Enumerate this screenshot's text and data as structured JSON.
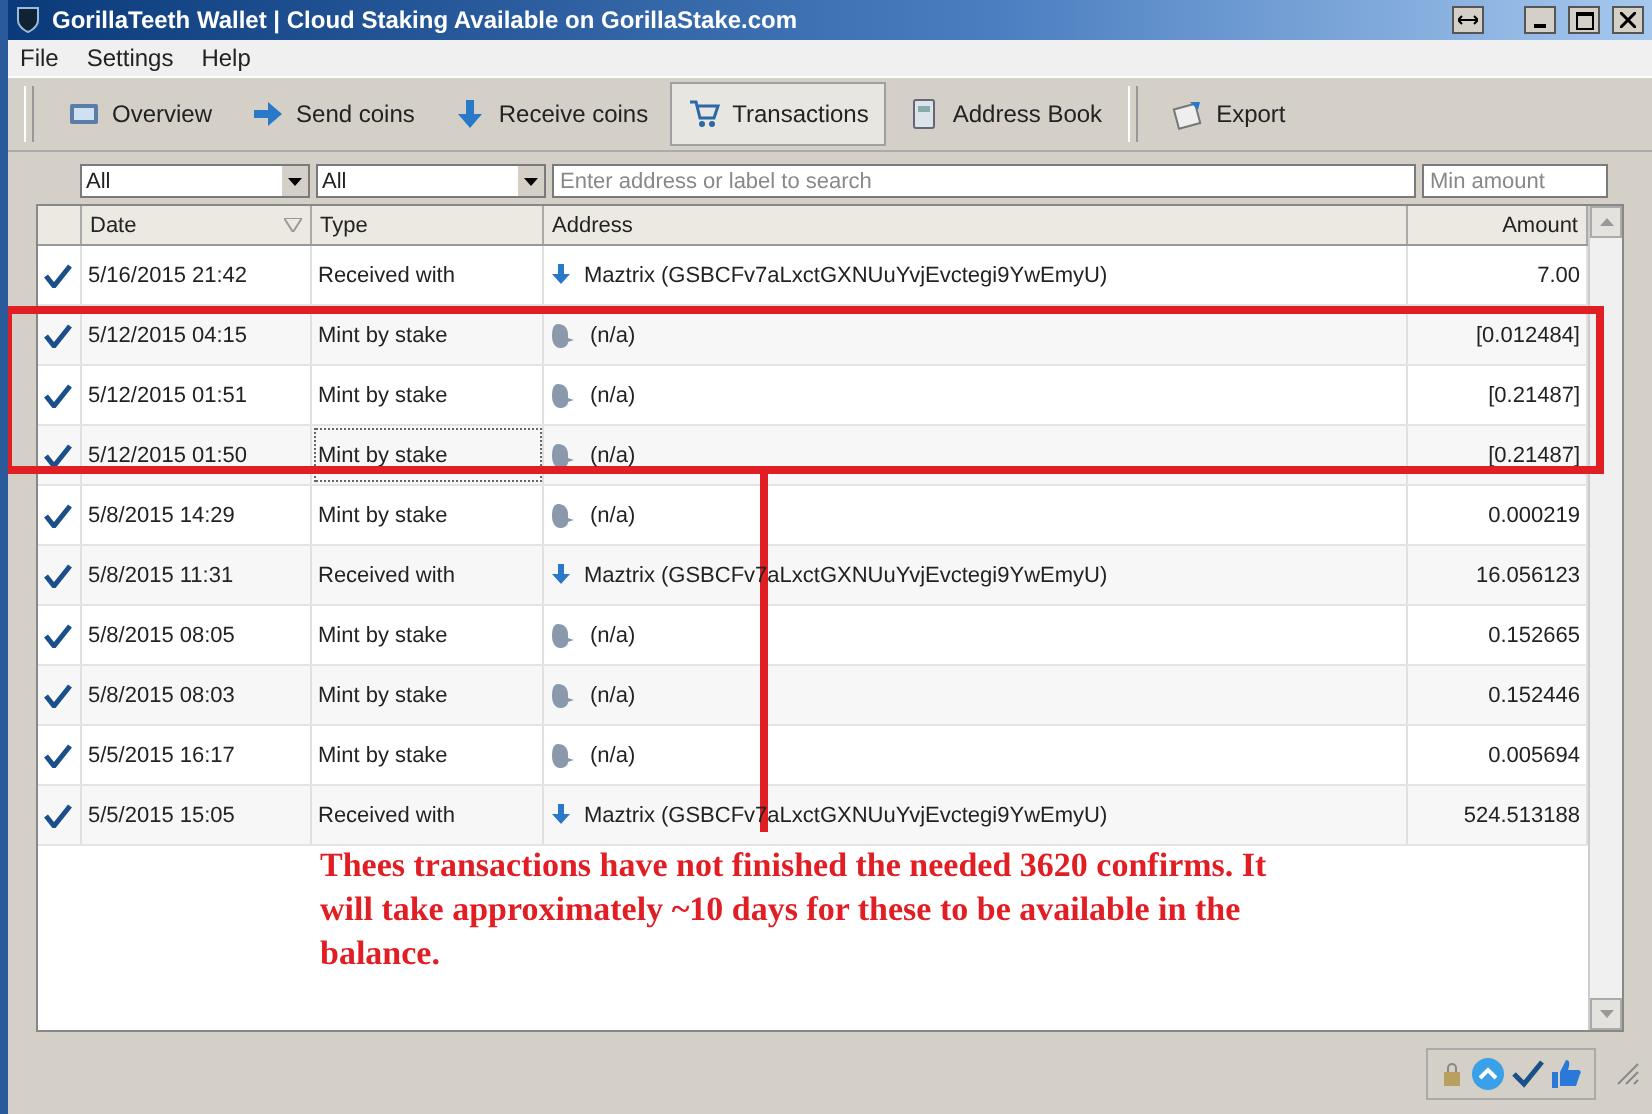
{
  "window": {
    "title": "GorillaTeeth Wallet | Cloud Staking Available on GorillaStake.com"
  },
  "menu": [
    "File",
    "Settings",
    "Help"
  ],
  "toolbar": [
    {
      "label": "Overview",
      "selected": false
    },
    {
      "label": "Send coins",
      "selected": false
    },
    {
      "label": "Receive coins",
      "selected": false
    },
    {
      "label": "Transactions",
      "selected": true
    },
    {
      "label": "Address Book",
      "selected": false
    },
    {
      "label": "Export",
      "selected": false
    }
  ],
  "filters": {
    "date": "All",
    "type": "All",
    "search": {
      "placeholder": "Enter address or label to search"
    },
    "min_amount": {
      "placeholder": "Min amount"
    }
  },
  "table": {
    "columns": [
      "Date",
      "Type",
      "Address",
      "Amount"
    ],
    "rows": [
      {
        "date": "5/16/2015 21:42",
        "type": "Received with",
        "kind": "received",
        "address": "Maztrix (GSBCFv7aLxctGXNUuYvjEvctegi9YwEmyU)",
        "amount": "7.00",
        "focused": false
      },
      {
        "date": "5/12/2015 04:15",
        "type": "Mint by stake",
        "kind": "mint",
        "address": "(n/a)",
        "amount": "[0.012484]",
        "focused": false
      },
      {
        "date": "5/12/2015 01:51",
        "type": "Mint by stake",
        "kind": "mint",
        "address": "(n/a)",
        "amount": "[0.21487]",
        "focused": false
      },
      {
        "date": "5/12/2015 01:50",
        "type": "Mint by stake",
        "kind": "mint",
        "address": "(n/a)",
        "amount": "[0.21487]",
        "focused": true
      },
      {
        "date": "5/8/2015 14:29",
        "type": "Mint by stake",
        "kind": "mint",
        "address": "(n/a)",
        "amount": "0.000219",
        "focused": false
      },
      {
        "date": "5/8/2015 11:31",
        "type": "Received with",
        "kind": "received",
        "address": "Maztrix (GSBCFv7aLxctGXNUuYvjEvctegi9YwEmyU)",
        "amount": "16.056123",
        "focused": false
      },
      {
        "date": "5/8/2015 08:05",
        "type": "Mint by stake",
        "kind": "mint",
        "address": "(n/a)",
        "amount": "0.152665",
        "focused": false
      },
      {
        "date": "5/8/2015 08:03",
        "type": "Mint by stake",
        "kind": "mint",
        "address": "(n/a)",
        "amount": "0.152446",
        "focused": false
      },
      {
        "date": "5/5/2015 16:17",
        "type": "Mint by stake",
        "kind": "mint",
        "address": "(n/a)",
        "amount": "0.005694",
        "focused": false
      },
      {
        "date": "5/5/2015 15:05",
        "type": "Received with",
        "kind": "received",
        "address": "Maztrix (GSBCFv7aLxctGXNUuYvjEvctegi9YwEmyU)",
        "amount": "524.513188",
        "focused": false
      }
    ]
  },
  "annotation": {
    "text": "Thees transactions have not finished the needed 3620 confirms. It will take approximately ~10 days for these to be available in the balance."
  }
}
